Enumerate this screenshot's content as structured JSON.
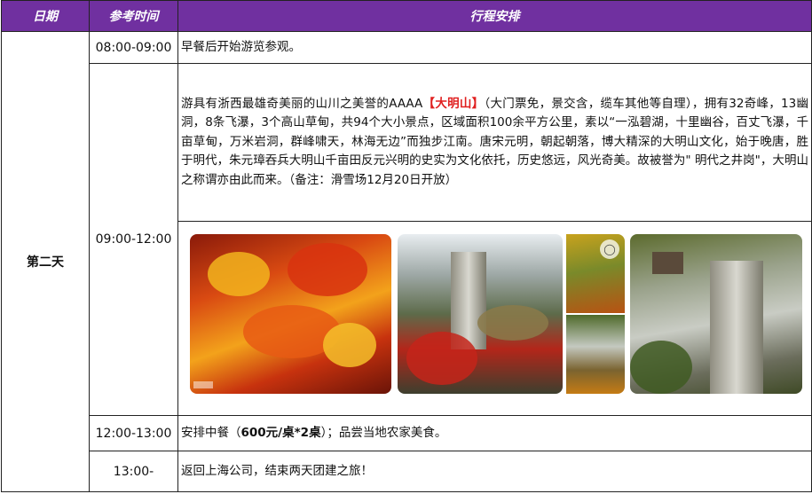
{
  "header": {
    "date_col": "日期",
    "time_col": "参考时间",
    "plan_col": "行程安排"
  },
  "day_label": "第二天",
  "rows": [
    {
      "time": "08:00-09:00",
      "text": "早餐后开始游览参观。"
    },
    {
      "time": "09:00-12:00",
      "text_before": "游具有浙西最雄奇美丽的山川之美誉的AAAA",
      "highlight": "【大明山】",
      "text_after": "（大门票免，景交含，缆车其他等自理），拥有32奇峰，13幽洞，8条飞瀑，3个高山草甸，共94个大小景点，区域面积100余平方公里，素以“一泓碧湖，十里幽谷，百丈飞瀑，千亩草甸，万米岩洞，群峰啸天，林海无边”而独步江南。唐宋元明，朝起朝落，博大精深的大明山文化，始于晚唐，胜于明代，朱元璋吞兵大明山千亩田反元兴明的史实为文化依托，历史悠远，风光奇美。故被誉为\" 明代之井岗\"，大明山之称谓亦由此而来。（备注：滑雪场12月20日开放）",
      "photos": [
        "红枫林",
        "红叶栈道",
        "秋色山林",
        "瀑布峡谷",
        "悬崖观景台"
      ]
    },
    {
      "time": "12:00-13:00",
      "text_before": "安排中餐（",
      "bold": "600元/桌*2桌",
      "text_after": "）；品尝当地农家美食。"
    },
    {
      "time": "13:00-",
      "text": "返回上海公司，结束两天团建之旅！"
    }
  ],
  "colors": {
    "header_bg": "#7030a0",
    "highlight": "#e02020"
  }
}
